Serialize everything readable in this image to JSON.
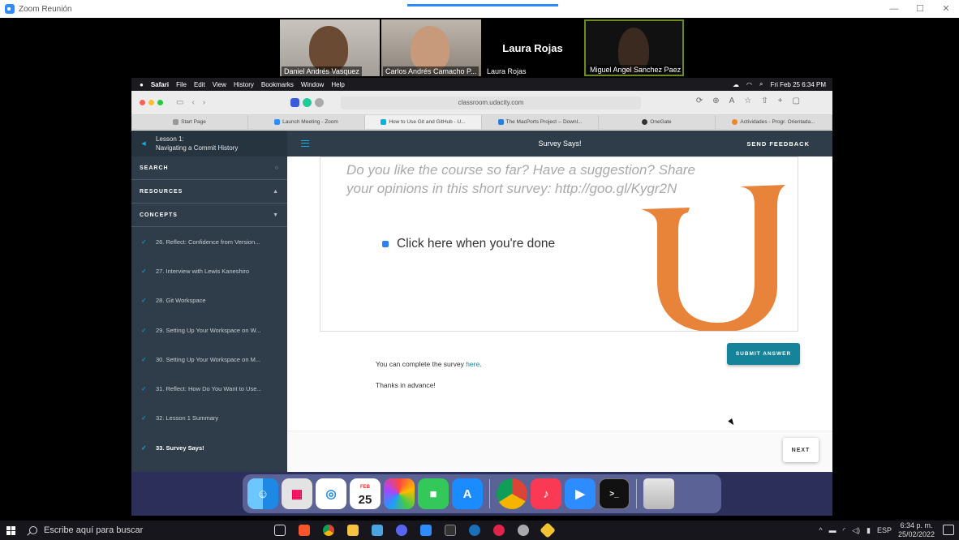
{
  "zoom": {
    "title": "Zoom Reunión",
    "window_controls": [
      "—",
      "☐",
      "✕"
    ],
    "participants": [
      {
        "name": "Daniel Andrés Vasquez"
      },
      {
        "name": "Carlos Andrés Camacho P..."
      },
      {
        "name": "Laura Rojas",
        "display_name": "Laura Rojas"
      },
      {
        "name": "Miguel Angel Sanchez Paez"
      }
    ]
  },
  "mac": {
    "menubar": [
      "Safari",
      "File",
      "Edit",
      "View",
      "History",
      "Bookmarks",
      "Window",
      "Help"
    ],
    "clock": "Fri Feb 25  6:34 PM"
  },
  "safari": {
    "address": "classroom.udacity.com",
    "tabs": [
      {
        "label": "Start Page",
        "color": "#999999"
      },
      {
        "label": "Launch Meeting - Zoom",
        "color": "#2d8cff"
      },
      {
        "label": "How to Use Git and GitHub - U...",
        "color": "#02b3e4"
      },
      {
        "label": "The MacPorts Project -- Downl...",
        "color": "#2a7de1"
      },
      {
        "label": "OneGate",
        "color": "#333333"
      },
      {
        "label": "Actividades - Progr. Orientada...",
        "color": "#f0862a"
      }
    ]
  },
  "sidebar": {
    "lesson_line1": "Lesson 1:",
    "lesson_line2": "Navigating a Commit History",
    "search_label": "SEARCH",
    "resources_label": "RESOURCES",
    "concepts_label": "CONCEPTS",
    "concepts": [
      {
        "label": "26. Reflect: Confidence from Version..."
      },
      {
        "label": "27. Interview with Lewis Kaneshiro"
      },
      {
        "label": "28. Git Workspace"
      },
      {
        "label": "29. Setting Up Your Workspace on W..."
      },
      {
        "label": "30. Setting Up Your Workspace on M..."
      },
      {
        "label": "31. Reflect: How Do You Want to Use..."
      },
      {
        "label": "32. Lesson 1 Summary"
      },
      {
        "label": "33. Survey Says!",
        "active": true
      }
    ]
  },
  "main": {
    "title": "Survey Says!",
    "feedback": "SEND FEEDBACK",
    "survey_line1": "Do you like the course so far? Have a suggestion? Share",
    "survey_line2": "your opinions in this short survey: http://goo.gl/Kygr2N",
    "checkbox_label": "Click here when you're done",
    "submit": "SUBMIT ANSWER",
    "complete_text": "You can complete the survey ",
    "complete_link": "here",
    "complete_end": ".",
    "thanks": "Thanks in advance!",
    "next": "NEXT",
    "brand_color": "#e8833a",
    "accent": "#15849a"
  },
  "dock": {
    "apps": [
      "finder",
      "launchpad",
      "safari",
      "calendar",
      "photos",
      "facetime",
      "app-store",
      "chrome",
      "music",
      "zoom",
      "terminal",
      "trash"
    ],
    "calendar_month": "FEB",
    "calendar_day": "25"
  },
  "taskbar": {
    "search_placeholder": "Escribe aquí para buscar",
    "lang": "ESP",
    "time": "6:34 p. m.",
    "date": "25/02/2022"
  }
}
